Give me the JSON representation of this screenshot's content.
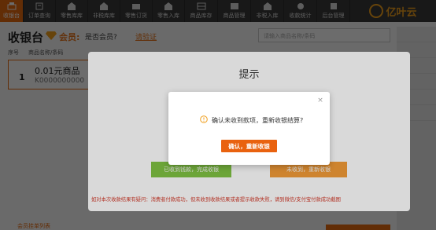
{
  "nav": {
    "items": [
      {
        "label": "收银台",
        "icon": "cashier-icon"
      },
      {
        "label": "订单查询",
        "icon": "order-search-icon"
      },
      {
        "label": "零售库库",
        "icon": "retail-stock-icon"
      },
      {
        "label": "非税库库",
        "icon": "nontax-stock-icon"
      },
      {
        "label": "零售订货",
        "icon": "retail-order-icon"
      },
      {
        "label": "零售入库",
        "icon": "retail-inbound-icon"
      },
      {
        "label": "商品库存",
        "icon": "stock-icon"
      },
      {
        "label": "商品管理",
        "icon": "goods-manage-icon"
      },
      {
        "label": "非税入库",
        "icon": "nontax-inbound-icon"
      },
      {
        "label": "收款统计",
        "icon": "stats-icon"
      },
      {
        "label": "后台管理",
        "icon": "admin-icon"
      }
    ],
    "logo_text": "亿叶云"
  },
  "page": {
    "title": "收银台",
    "vip_label": "会员:",
    "member_question": "是否会员?",
    "member_link": "请验证",
    "search_placeholder": "请输入商品名称/条码",
    "columns": [
      "序号",
      "商品名称/条码"
    ],
    "item": {
      "no": "1",
      "name": "0.01元商品",
      "code": "K0000000000"
    },
    "bottom_link": "会员挂单列表"
  },
  "outer_dialog": {
    "title": "提示",
    "btn_received": "已收到钱款，完成收银",
    "btn_unreceived": "未收到，重新收银",
    "note": "如对本次收款结果有疑问：消费者付款成功，但未收到收款结果或者提示收款失败，请到微信/支付宝付款成功截图"
  },
  "confirm_dialog": {
    "message": "确认未收到款项，重新收银结算?",
    "confirm_label": "确认，重新收银",
    "close_label": "×"
  },
  "colors": {
    "accent": "#e9620f",
    "nav_bg": "#3a3a3a",
    "green_btn": "#7fc242",
    "orange_btn": "#f29c38",
    "note_red": "#d23a2a"
  }
}
